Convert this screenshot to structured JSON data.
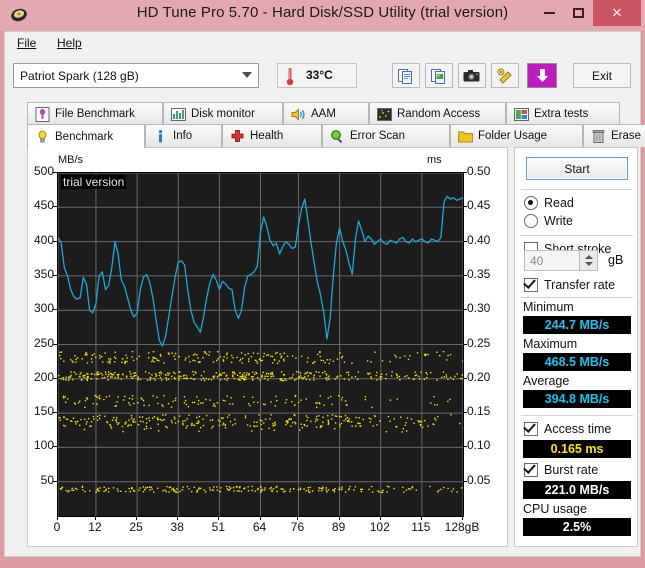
{
  "window": {
    "title": "HD Tune Pro 5.70 - Hard Disk/SSD Utility (trial version)",
    "app_icon": "disk-icon",
    "minimize_label": "–",
    "maximize_label": "□",
    "close_label": "×",
    "titlebar_color": "#e4a8b0",
    "close_color": "#ca5662"
  },
  "menu": {
    "items": [
      {
        "label": "File"
      },
      {
        "label": "Help"
      }
    ]
  },
  "toolbar": {
    "drive_selected": "Patriot Spark (128 gB)",
    "temperature": "33°C",
    "exit_label": "Exit",
    "icons": [
      {
        "name": "copy-icon"
      },
      {
        "name": "copy-image-icon"
      },
      {
        "name": "camera-icon"
      },
      {
        "name": "tools-icon"
      },
      {
        "name": "download-arrow-icon"
      }
    ]
  },
  "tabs": {
    "top_row": [
      {
        "label": "File Benchmark",
        "icon": "file-benchmark-icon",
        "active": false
      },
      {
        "label": "Disk monitor",
        "icon": "disk-monitor-icon",
        "active": false
      },
      {
        "label": "AAM",
        "icon": "speaker-icon",
        "active": false
      },
      {
        "label": "Random Access",
        "icon": "random-access-icon",
        "active": false
      },
      {
        "label": "Extra tests",
        "icon": "extra-tests-icon",
        "active": false
      }
    ],
    "bottom_row": [
      {
        "label": "Benchmark",
        "icon": "bulb-icon",
        "active": true
      },
      {
        "label": "Info",
        "icon": "info-icon",
        "active": false
      },
      {
        "label": "Health",
        "icon": "health-cross-icon",
        "active": false
      },
      {
        "label": "Error Scan",
        "icon": "magnifier-icon",
        "active": false
      },
      {
        "label": "Folder Usage",
        "icon": "folder-icon",
        "active": false
      },
      {
        "label": "Erase",
        "icon": "trash-icon",
        "active": false
      }
    ]
  },
  "sidebar": {
    "start_label": "Start",
    "mode": [
      {
        "label": "Read",
        "selected": true
      },
      {
        "label": "Write",
        "selected": false
      }
    ],
    "short_stroke": {
      "label": "Short stroke",
      "checked": false,
      "value": "40",
      "unit": "gB"
    },
    "transfer_rate": {
      "label": "Transfer rate",
      "checked": true
    },
    "minimum": {
      "label": "Minimum",
      "value": "244.7 MB/s"
    },
    "maximum": {
      "label": "Maximum",
      "value": "468.5 MB/s"
    },
    "average": {
      "label": "Average",
      "value": "394.8 MB/s"
    },
    "access_time": {
      "label": "Access time",
      "checked": true,
      "value": "0.165 ms"
    },
    "burst_rate": {
      "label": "Burst rate",
      "checked": true,
      "value": "221.0 MB/s"
    },
    "cpu_usage": {
      "label": "CPU usage",
      "value": "2.5%"
    }
  },
  "chart_data": {
    "type": "line",
    "title": "",
    "watermark": "trial version",
    "ylabel": "MB/s",
    "y2label": "ms",
    "xlabel": "",
    "xlim": [
      0,
      128
    ],
    "ylim": [
      0,
      500
    ],
    "y2lim": [
      0,
      0.5
    ],
    "grid": true,
    "xticks": [
      0,
      12,
      25,
      38,
      51,
      64,
      76,
      89,
      102,
      115,
      128
    ],
    "xticklabels": [
      "0",
      "12",
      "25",
      "38",
      "51",
      "64",
      "76",
      "89",
      "102",
      "115",
      "128gB"
    ],
    "yticks": [
      50,
      100,
      150,
      200,
      250,
      300,
      350,
      400,
      450,
      500
    ],
    "yticklabels": [
      "50",
      "100",
      "150",
      "200",
      "250",
      "300",
      "350",
      "400",
      "450",
      "500"
    ],
    "y2ticks": [
      0.05,
      0.1,
      0.15,
      0.2,
      0.25,
      0.3,
      0.35,
      0.4,
      0.45,
      0.5
    ],
    "y2ticklabels": [
      "0.05",
      "0.10",
      "0.15",
      "0.20",
      "0.25",
      "0.30",
      "0.35",
      "0.40",
      "0.45",
      "0.50"
    ],
    "series": [
      {
        "name": "Transfer rate",
        "color": "#18a9e0",
        "axis": "left",
        "unit": "MB/s",
        "x": [
          0,
          1,
          2,
          3,
          4,
          5,
          6,
          7,
          8,
          9,
          10,
          11,
          12,
          13,
          14,
          15,
          16,
          17,
          18,
          19,
          20,
          21,
          22,
          23,
          24,
          25,
          26,
          27,
          28,
          29,
          30,
          31,
          32,
          33,
          34,
          35,
          36,
          37,
          38,
          39,
          40,
          41,
          42,
          43,
          44,
          45,
          46,
          47,
          48,
          49,
          50,
          51,
          52,
          53,
          54,
          55,
          56,
          57,
          58,
          59,
          60,
          61,
          62,
          63,
          64,
          65,
          66,
          67,
          68,
          69,
          70,
          71,
          72,
          73,
          74,
          75,
          76,
          77,
          78,
          79,
          80,
          81,
          82,
          83,
          84,
          85,
          86,
          87,
          88,
          89,
          90,
          91,
          92,
          93,
          94,
          95,
          96,
          97,
          98,
          99,
          100,
          101,
          102,
          103,
          104,
          105,
          106,
          107,
          108,
          109,
          110,
          111,
          112,
          113,
          114,
          115,
          116,
          117,
          118,
          119,
          120,
          121,
          122,
          123,
          124,
          125,
          126,
          127,
          128
        ],
        "values": [
          406,
          398,
          362,
          350,
          330,
          320,
          316,
          318,
          348,
          338,
          300,
          296,
          310,
          350,
          356,
          330,
          336,
          362,
          400,
          382,
          344,
          335,
          318,
          300,
          290,
          296,
          330,
          348,
          352,
          340,
          318,
          286,
          256,
          248,
          262,
          290,
          320,
          348,
          370,
          372,
          366,
          330,
          300,
          282,
          276,
          268,
          290,
          318,
          340,
          352,
          344,
          330,
          342,
          338,
          332,
          330,
          300,
          288,
          300,
          334,
          350,
          352,
          356,
          364,
          414,
          436,
          422,
          402,
          394,
          398,
          382,
          392,
          400,
          396,
          390,
          392,
          424,
          448,
          462,
          430,
          398,
          368,
          340,
          322,
          296,
          258,
          288,
          350,
          398,
          420,
          400,
          388,
          368,
          352,
          404,
          430,
          416,
          400,
          408,
          404,
          396,
          400,
          404,
          398,
          396,
          402,
          400,
          398,
          404,
          406,
          400,
          398,
          404,
          400,
          402,
          404,
          400,
          398,
          404,
          402,
          400,
          406,
          458,
          466,
          462,
          464,
          460,
          462,
          464
        ],
        "stats": {
          "minimum": 244.7,
          "maximum": 468.5,
          "average": 394.8
        }
      },
      {
        "name": "Access time",
        "color": "#ffe400",
        "axis": "right",
        "unit": "ms",
        "marker": "dot",
        "style": "scatter",
        "bands_ms": [
          0.232,
          0.205,
          0.168,
          0.14,
          0.132,
          0.04
        ],
        "value": 0.165
      }
    ]
  }
}
